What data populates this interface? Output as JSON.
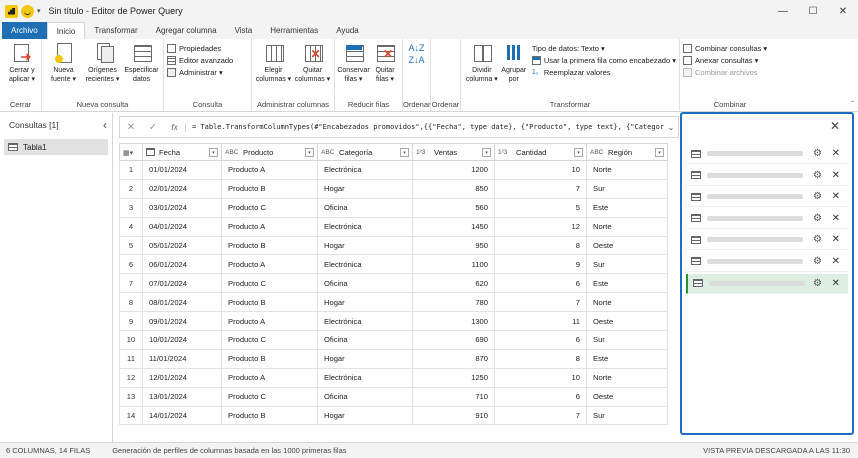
{
  "window": {
    "title": "Sin título - Editor de Power Query",
    "qa_dropdown": "▾",
    "minimize": "—",
    "restore": "☐",
    "close": "✕"
  },
  "tabs": [
    {
      "label": "Archivo"
    },
    {
      "label": "Inicio"
    },
    {
      "label": "Transformar"
    },
    {
      "label": "Agregar columna"
    },
    {
      "label": "Vista"
    },
    {
      "label": "Herramientas"
    },
    {
      "label": "Ayuda"
    }
  ],
  "ribbon": {
    "cerrar": {
      "label": "Cerrar",
      "apply_l1": "Cerrar y",
      "apply_l2": "aplicar ▾"
    },
    "nueva_consulta": {
      "label": "Nueva consulta",
      "nueva_l1": "Nueva",
      "nueva_l2": "fuente ▾",
      "orig_l1": "Orígenes",
      "orig_l2": "recientes ▾",
      "spec_l1": "Especificar",
      "spec_l2": "datos"
    },
    "consulta": {
      "label": "Consulta",
      "propiedades": "Propiedades",
      "editor": "Editor avanzado",
      "administrar": "Administrar ▾"
    },
    "columnas": {
      "label": "Administrar columnas",
      "elegir_l1": "Elegir",
      "elegir_l2": "columnas ▾",
      "quitar_l1": "Quitar",
      "quitar_l2": "columnas ▾"
    },
    "filas": {
      "label": "Reducir filas",
      "conservar_l1": "Conservar",
      "conservar_l2": "filas ▾",
      "quitar_l1": "Quitar",
      "quitar_l2": "filas ▾"
    },
    "ordenar1": {
      "label": "Ordenar",
      "asc": "A↓Z",
      "desc": "Z↓A"
    },
    "ordenar2": {
      "label": "Ordenar"
    },
    "transformar": {
      "label": "Transformar",
      "dividir_l1": "Dividir",
      "dividir_l2": "columna ▾",
      "agrupar_l1": "Agrupar",
      "agrupar_l2": "por",
      "tipo": "Tipo de datos: Texto ▾",
      "primera": "Usar la primera fila como encabezado ▾",
      "reemplazar": "Reemplazar valores",
      "repl_icon": "1₂"
    },
    "combinar": {
      "label": "Combinar",
      "combinar": "Combinar consultas ▾",
      "anexar": "Anexar consultas ▾",
      "archivos": "Combinar archivos"
    },
    "collapse": "ˆ"
  },
  "queries": {
    "header": "Consultas [1]",
    "collapse": "‹",
    "items": [
      {
        "label": "Tabla1"
      }
    ]
  },
  "formula_bar": {
    "cancel": "✕",
    "commit": "✓",
    "fx": "fx",
    "text": "= Table.TransformColumnTypes(#\"Encabezados promovidos\",{{\"Fecha\", type date}, {\"Producto\", type text}, {\"Categoría\", type text},",
    "expand": "⌄"
  },
  "grid": {
    "columns": [
      {
        "name": "Fecha",
        "type": "date"
      },
      {
        "name": "Producto",
        "type": "ABC"
      },
      {
        "name": "Categoría",
        "type": "ABC"
      },
      {
        "name": "Ventas",
        "type": "123"
      },
      {
        "name": "Cantidad",
        "type": "123"
      },
      {
        "name": "Región",
        "type": "ABC"
      }
    ],
    "type_labels": {
      "ABC": "ABC",
      "123": "1²3"
    },
    "dd_glyph": "▾",
    "corner": "▦▾",
    "rows": [
      [
        "1",
        "01/01/2024",
        "Producto A",
        "Electrónica",
        "1200",
        "10",
        "Norte"
      ],
      [
        "2",
        "02/01/2024",
        "Producto B",
        "Hogar",
        "850",
        "7",
        "Sur"
      ],
      [
        "3",
        "03/01/2024",
        "Producto C",
        "Oficina",
        "560",
        "5",
        "Este"
      ],
      [
        "4",
        "04/01/2024",
        "Producto A",
        "Electrónica",
        "1450",
        "12",
        "Norte"
      ],
      [
        "5",
        "05/01/2024",
        "Producto B",
        "Hogar",
        "950",
        "8",
        "Oeste"
      ],
      [
        "6",
        "06/01/2024",
        "Producto A",
        "Electrónica",
        "1100",
        "9",
        "Sur"
      ],
      [
        "7",
        "07/01/2024",
        "Producto C",
        "Oficina",
        "620",
        "6",
        "Este"
      ],
      [
        "8",
        "08/01/2024",
        "Producto B",
        "Hogar",
        "780",
        "7",
        "Norte"
      ],
      [
        "9",
        "09/01/2024",
        "Producto A",
        "Electrónica",
        "1300",
        "11",
        "Oeste"
      ],
      [
        "10",
        "10/01/2024",
        "Producto C",
        "Oficina",
        "690",
        "6",
        "Sur"
      ],
      [
        "11",
        "11/01/2024",
        "Producto B",
        "Hogar",
        "870",
        "8",
        "Este"
      ],
      [
        "12",
        "12/01/2024",
        "Producto A",
        "Electrónica",
        "1250",
        "10",
        "Norte"
      ],
      [
        "13",
        "13/01/2024",
        "Producto C",
        "Oficina",
        "710",
        "6",
        "Oeste"
      ],
      [
        "14",
        "14/01/2024",
        "Producto B",
        "Hogar",
        "910",
        "7",
        "Sur"
      ]
    ]
  },
  "right_panel": {
    "close": "✕",
    "gear": "⚙",
    "x": "✕",
    "items": 7,
    "selected_index": 6
  },
  "status": {
    "left": "6 COLUMNAS, 14 FILAS",
    "middle": "Generación de perfiles de columnas basada en las 1000 primeras filas",
    "right": "VISTA PREVIA DESCARGADA A LAS 11:30"
  }
}
